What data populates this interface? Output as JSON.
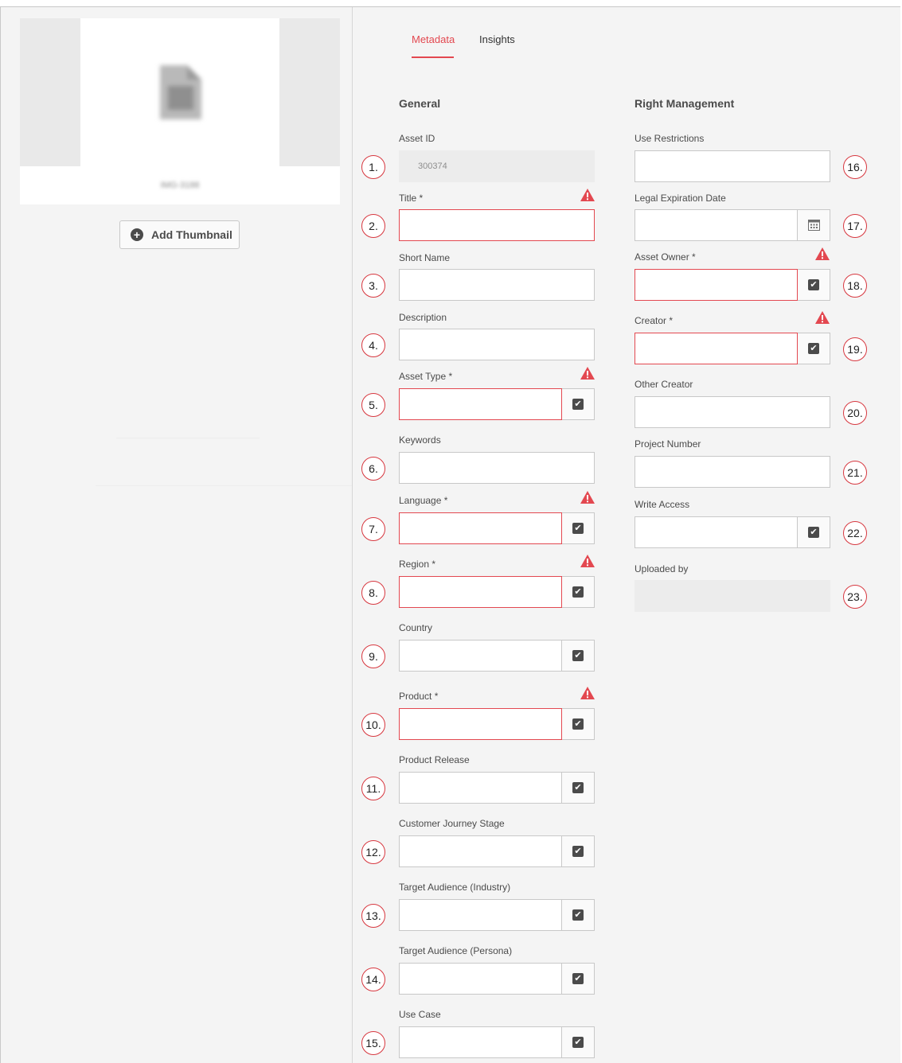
{
  "thumbnail": {
    "filename": "IMG-3188",
    "add_label": "Add Thumbnail"
  },
  "tabs": [
    {
      "label": "Metadata"
    },
    {
      "label": "Insights"
    }
  ],
  "general": {
    "title": "General",
    "fields": [
      {
        "n": "1.",
        "label": "Asset ID",
        "value": "300374"
      },
      {
        "n": "2.",
        "label": "Title *"
      },
      {
        "n": "3.",
        "label": "Short Name"
      },
      {
        "n": "4.",
        "label": "Description"
      },
      {
        "n": "5.",
        "label": "Asset Type *"
      },
      {
        "n": "6.",
        "label": "Keywords"
      },
      {
        "n": "7.",
        "label": "Language *"
      },
      {
        "n": "8.",
        "label": "Region *"
      },
      {
        "n": "9.",
        "label": "Country"
      },
      {
        "n": "10.",
        "label": "Product *"
      },
      {
        "n": "11.",
        "label": "Product Release"
      },
      {
        "n": "12.",
        "label": "Customer Journey Stage"
      },
      {
        "n": "13.",
        "label": "Target Audience (Industry)"
      },
      {
        "n": "14.",
        "label": "Target Audience (Persona)"
      },
      {
        "n": "15.",
        "label": "Use Case"
      }
    ]
  },
  "rights": {
    "title": "Right Management",
    "fields": [
      {
        "n": "16.",
        "label": "Use Restrictions"
      },
      {
        "n": "17.",
        "label": "Legal Expiration Date"
      },
      {
        "n": "18.",
        "label": "Asset Owner *"
      },
      {
        "n": "19.",
        "label": "Creator *"
      },
      {
        "n": "20.",
        "label": "Other Creator"
      },
      {
        "n": "21.",
        "label": "Project Number"
      },
      {
        "n": "22.",
        "label": "Write Access"
      },
      {
        "n": "23.",
        "label": "Uploaded by"
      }
    ]
  },
  "icons": {
    "warning": "alert-triangle-icon",
    "check": "checkbox-checked-icon",
    "calendar": "calendar-icon",
    "add": "plus-circle-icon"
  },
  "colors": {
    "accent": "#e34850",
    "error_border": "#e34850",
    "marker": "#d7373f"
  }
}
